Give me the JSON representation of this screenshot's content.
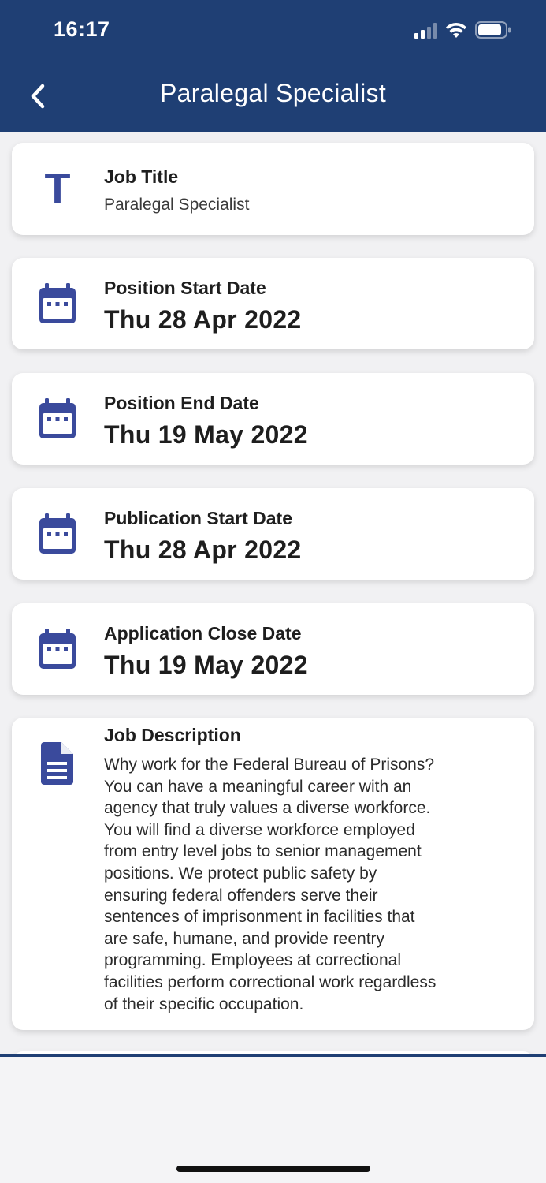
{
  "status_bar": {
    "time": "16:17"
  },
  "nav": {
    "title": "Paralegal Specialist"
  },
  "cards": [
    {
      "label": "Job Title",
      "value": "Paralegal Specialist",
      "icon": "title-T-icon"
    },
    {
      "label": "Position Start Date",
      "value": "Thu 28 Apr 2022",
      "icon": "calendar-icon"
    },
    {
      "label": "Position End Date",
      "value": "Thu 19 May 2022",
      "icon": "calendar-icon"
    },
    {
      "label": "Publication Start Date",
      "value": "Thu 28 Apr 2022",
      "icon": "calendar-icon"
    },
    {
      "label": "Application Close Date",
      "value": "Thu 19 May 2022",
      "icon": "calendar-icon"
    }
  ],
  "description": {
    "label": "Job Description",
    "icon": "document-icon",
    "lines": [
      "Why work for the Federal Bureau of Prisons?",
      "You can have a meaningful career with an",
      "agency that truly values a diverse workforce.",
      "You will find a diverse workforce employed",
      "from entry level jobs to senior management",
      "positions. We protect public safety by",
      "ensuring federal offenders serve their",
      "sentences of imprisonment in facilities that",
      "are safe, humane, and provide reentry",
      "programming. Employees at correctional",
      "facilities perform correctional work regardless",
      "of their specific occupation."
    ]
  },
  "colors": {
    "header": "#1f3f74",
    "icon": "#3a4a9c",
    "background": "#f1f1f3"
  }
}
